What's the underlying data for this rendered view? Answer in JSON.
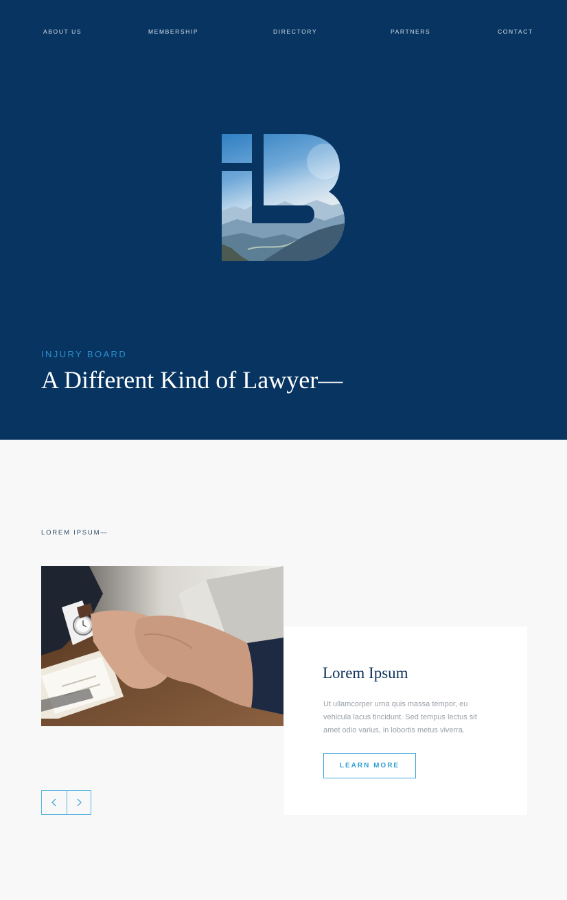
{
  "nav": {
    "items": [
      {
        "label": "ABOUT US"
      },
      {
        "label": "MEMBERSHIP"
      },
      {
        "label": "DIRECTORY"
      },
      {
        "label": "PARTNERS"
      },
      {
        "label": "CONTACT"
      }
    ]
  },
  "hero": {
    "logo_icon": "ib-monogram-mountain-logo",
    "eyebrow": "INJURY BOARD",
    "title": "A Different Kind of Lawyer—"
  },
  "feature": {
    "section_label": "LOREM IPSUM—",
    "image_icon": "handshake-photo",
    "card": {
      "title": "Lorem Ipsum",
      "text": "Ut ullamcorper urna quis massa tempor, eu vehicula lacus tincidunt. Sed tempus lectus sit amet odio varius, in lobortis metus viverra.",
      "button_label": "LEARN MORE"
    },
    "slider": {
      "prev_icon": "chevron-left-icon",
      "next_icon": "chevron-right-icon"
    }
  },
  "colors": {
    "hero_bg": "#073460",
    "accent": "#2e8fd0",
    "page_bg": "#f8f8f8",
    "heading": "#0d3158"
  }
}
